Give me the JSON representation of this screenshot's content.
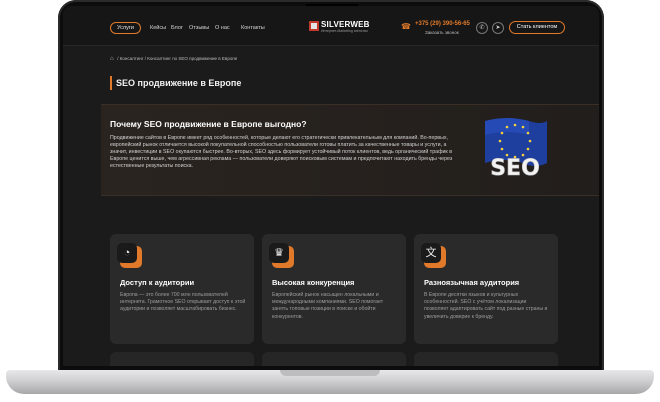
{
  "header": {
    "nav": [
      "Услуги",
      "Кейсы",
      "Блог",
      "Отзывы",
      "О нас",
      "Контакты"
    ],
    "services_chevron": "⌄",
    "about_chevron": "⌄",
    "logo_title": "SILVERWEB",
    "logo_subtitle": "Интернет-Marketing агенство",
    "phone": "+375 (29) 390-56-65",
    "callback": "Заказать звонок",
    "cta": "Стать клиентом"
  },
  "breadcrumb": {
    "items": [
      "Консалтинг",
      "Консалтинг по SEO продвижение в Европе"
    ]
  },
  "page_title": "SEO продвижение в Европе",
  "intro": {
    "title": "Почему SEO продвижение в Европе выгодно?",
    "text": "Продвижение сайтов в Европе имеет ряд особенностей, которые делают его стратегически привлекательным для компаний. Во-первых, европейский рынок отличается высокой покупательной способностью пользователи готовы платить за качественные товары и услуги, а значит, инвестиции в SEO окупаются быстрее. Во-вторых, SEO здесь формирует устойчивый поток клиентов, ведь органический трафик в Европе ценится выше, чем агрессивная реклама — пользователи доверяют поисковым системам и предпочитают находить бренды через естественные результаты поиска.",
    "art_text": "SEO"
  },
  "cards": [
    {
      "title": "Доступ к аудитории",
      "text": "Европа — это более 700 млн пользователей интернета. Грамотное SEO открывает доступ к этой аудитории и позволяет масштабировать бизнес."
    },
    {
      "title": "Высокая конкуренция",
      "text": "Европейский рынок насыщен локальными и международными компаниями. SEO помогает занять топовые позиции в поиске и обойти конкурентов."
    },
    {
      "title": "Разноязычная аудитория",
      "text": "В Европе десятки языков и культурных особенностей. SEO с учётом локализации позволяет адаптировать сайт под разные страны и увеличить доверие к бренду."
    }
  ],
  "icons": {
    "card1": "globe-icon",
    "card2": "trophy-icon",
    "card3": "translate-icon",
    "card1_glyph": "◔",
    "card2_glyph": "♛",
    "card3_glyph": "文",
    "phone_glyph": "☎",
    "phone_btn_glyph": "✆",
    "telegram_glyph": "➤",
    "home_glyph": "⌂"
  },
  "colors": {
    "accent": "#e07a2a",
    "background": "#1b1b1c",
    "card": "#2a2a2b"
  }
}
